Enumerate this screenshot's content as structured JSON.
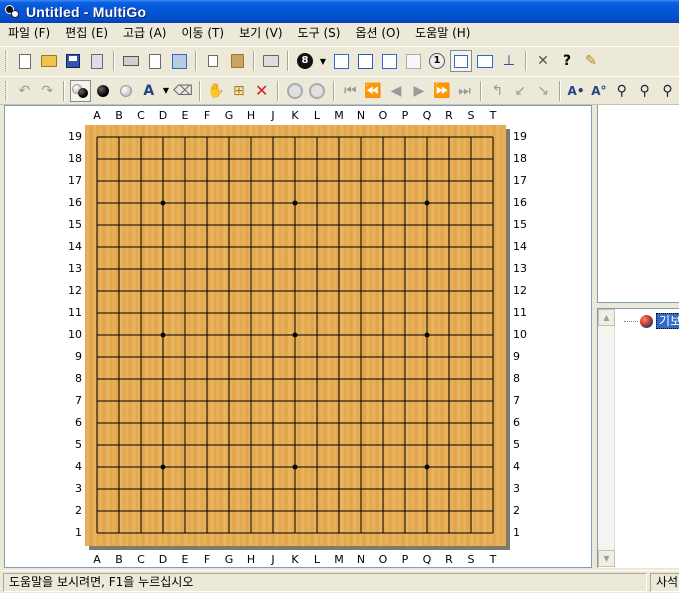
{
  "window": {
    "title": "Untitled - MultiGo"
  },
  "menu": [
    {
      "label": "파일 (F)"
    },
    {
      "label": "편집 (E)"
    },
    {
      "label": "고급 (A)"
    },
    {
      "label": "이동 (T)"
    },
    {
      "label": "보기 (V)"
    },
    {
      "label": "도구 (S)"
    },
    {
      "label": "옵션 (O)"
    },
    {
      "label": "도움말 (H)"
    }
  ],
  "toolbar1": {
    "icons": [
      "new-document-icon",
      "open-folder-icon",
      "save-icon",
      "save-as-icon",
      "print-icon",
      "print-preview-icon",
      "export-image-icon",
      "copy-icon",
      "paste-icon",
      "properties-icon",
      "move-number-icon",
      "dropdown-arrow-icon",
      "edit-comment-icon",
      "columns-icon",
      "rows-icon",
      "blank-board-icon",
      "numbered-stone-icon",
      "board-view-icon",
      "split-view-icon",
      "tree-view-icon",
      "tools-icon",
      "help-icon",
      "brush-icon"
    ],
    "number_badge_black": "8",
    "number_badge_white": "1"
  },
  "toolbar2": {
    "icons": [
      "undo-icon",
      "redo-icon",
      "alternate-stones-icon",
      "black-stone-icon",
      "white-stone-icon",
      "mark-icon",
      "dropdown-arrow-icon",
      "eraser-icon",
      "hand-icon",
      "add-variation-icon",
      "delete-icon",
      "previous-variation-icon",
      "next-variation-icon",
      "first-move-icon",
      "back-fast-icon",
      "back-icon",
      "forward-icon",
      "forward-fast-icon",
      "last-move-icon",
      "up-branch-icon",
      "branch-left-icon",
      "branch-right-icon",
      "find-black-icon",
      "find-white-icon",
      "search-icon",
      "search-prev-icon",
      "search-next-icon"
    ]
  },
  "board": {
    "size": 19,
    "columns": [
      "A",
      "B",
      "C",
      "D",
      "E",
      "F",
      "G",
      "H",
      "J",
      "K",
      "L",
      "M",
      "N",
      "O",
      "P",
      "Q",
      "R",
      "S",
      "T"
    ],
    "rows": [
      "19",
      "18",
      "17",
      "16",
      "15",
      "14",
      "13",
      "12",
      "11",
      "10",
      "9",
      "8",
      "7",
      "6",
      "5",
      "4",
      "3",
      "2",
      "1"
    ],
    "star_points": [
      [
        "D",
        "16"
      ],
      [
        "K",
        "16"
      ],
      [
        "Q",
        "16"
      ],
      [
        "D",
        "10"
      ],
      [
        "K",
        "10"
      ],
      [
        "Q",
        "10"
      ],
      [
        "D",
        "4"
      ],
      [
        "K",
        "4"
      ],
      [
        "Q",
        "4"
      ]
    ],
    "colors": {
      "wood": "#e4a84e",
      "line": "#000000"
    }
  },
  "tree": {
    "root_label": "기보"
  },
  "statusbar": {
    "help_text": "도움말을 보시려면, F1을 누르십시오",
    "pane_text": "사석"
  }
}
